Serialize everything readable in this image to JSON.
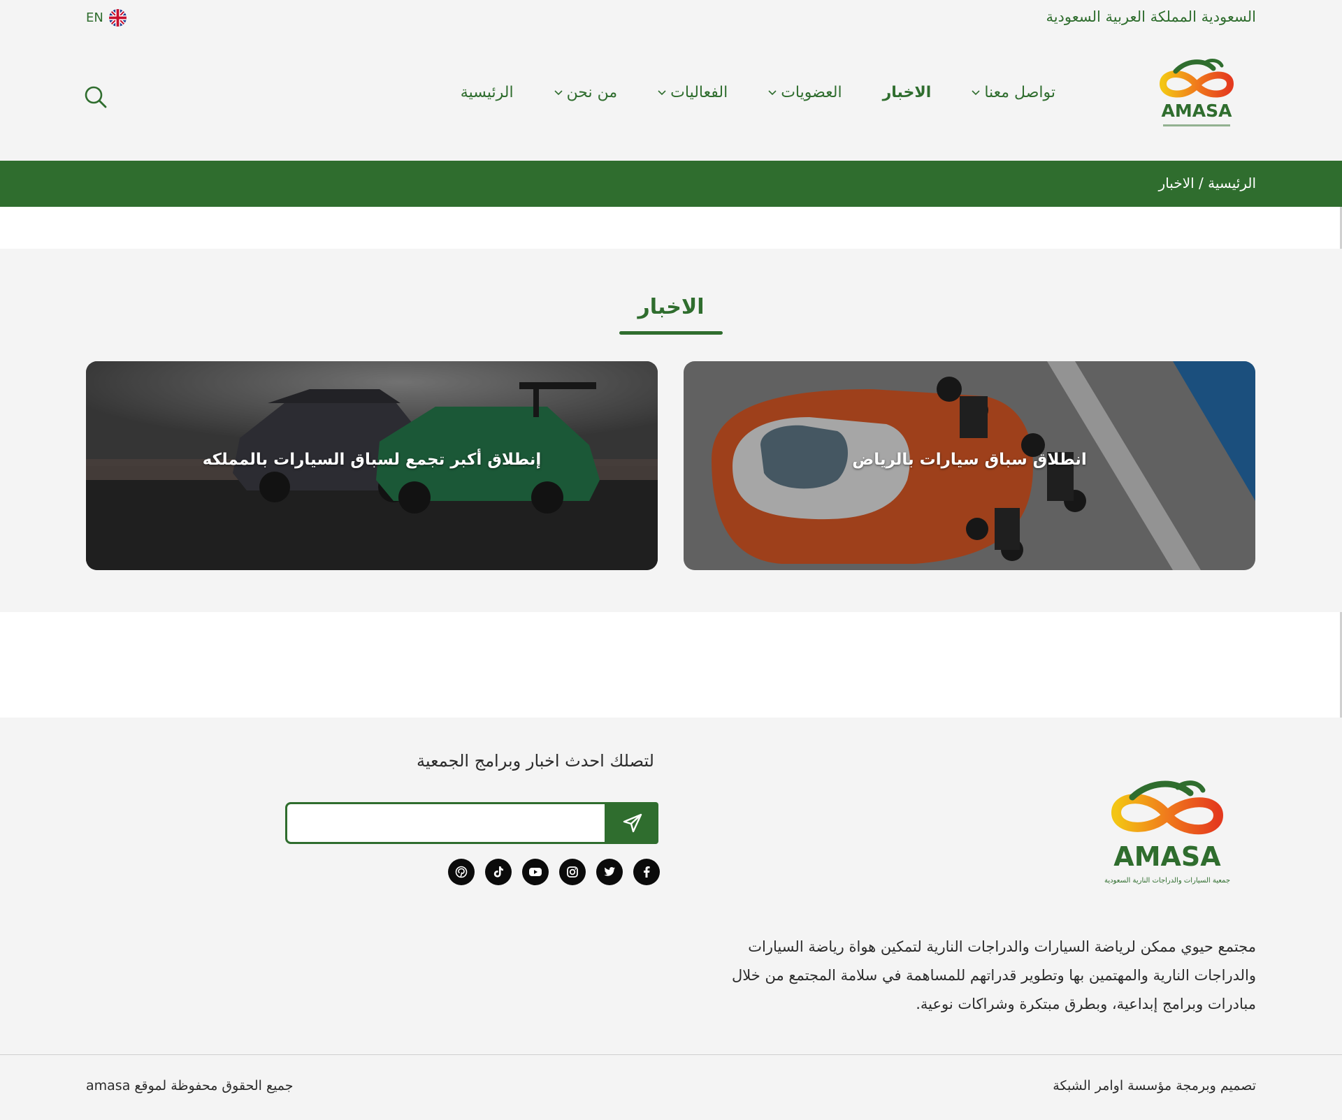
{
  "topbar": {
    "country": "السعودية المملكة العربية السعودية",
    "lang_label": "EN"
  },
  "brand": {
    "name": "AMASA",
    "tagline": "جمعية السيارات والدراجات النارية السعودية",
    "colors": {
      "green": "#2f6d2e",
      "yellow": "#f3c514",
      "orange": "#f07a1c",
      "red": "#e43a1e"
    }
  },
  "nav": {
    "items": [
      {
        "label": "الرئيسية",
        "has_dropdown": false
      },
      {
        "label": "من نحن",
        "has_dropdown": true
      },
      {
        "label": "الفعاليات",
        "has_dropdown": true
      },
      {
        "label": "العضويات",
        "has_dropdown": true
      },
      {
        "label": "الاخبار",
        "active": true
      },
      {
        "label": "تواصل معنا",
        "has_dropdown": true
      }
    ],
    "search_icon": "search-icon"
  },
  "breadcrumb": {
    "text": "الرئيسية / الاخبار"
  },
  "news": {
    "title": "الاخبار",
    "cards": [
      {
        "title": "انطلاق سباق سيارات بالرياض"
      },
      {
        "title": "إنطلاق أكبر تجمع لسباق السيارات بالمملكه"
      }
    ]
  },
  "footer": {
    "about": "مجتمع حيوي ممكن لرياضة السيارات والدراجات النارية لتمكين هواة رياضة السيارات والدراجات النارية والمهتمين بها وتطوير قدراتهم للمساهمة في سلامة المجتمع من خلال مبادرات وبرامج إبداعية، وبطرق مبتكرة وشراكات نوعية.",
    "newsletter_title": "لتصلك احدث اخبار وبرامج الجمعية",
    "newsletter_placeholder": "",
    "socials": [
      "facebook-icon",
      "twitter-icon",
      "instagram-icon",
      "youtube-icon",
      "tiktok-icon",
      "pinterest-icon"
    ],
    "credit": "تصميم وبرمجة مؤسسة اوامر الشبكة",
    "copyright": "جميع الحقوق محفوظة لموقع amasa"
  }
}
